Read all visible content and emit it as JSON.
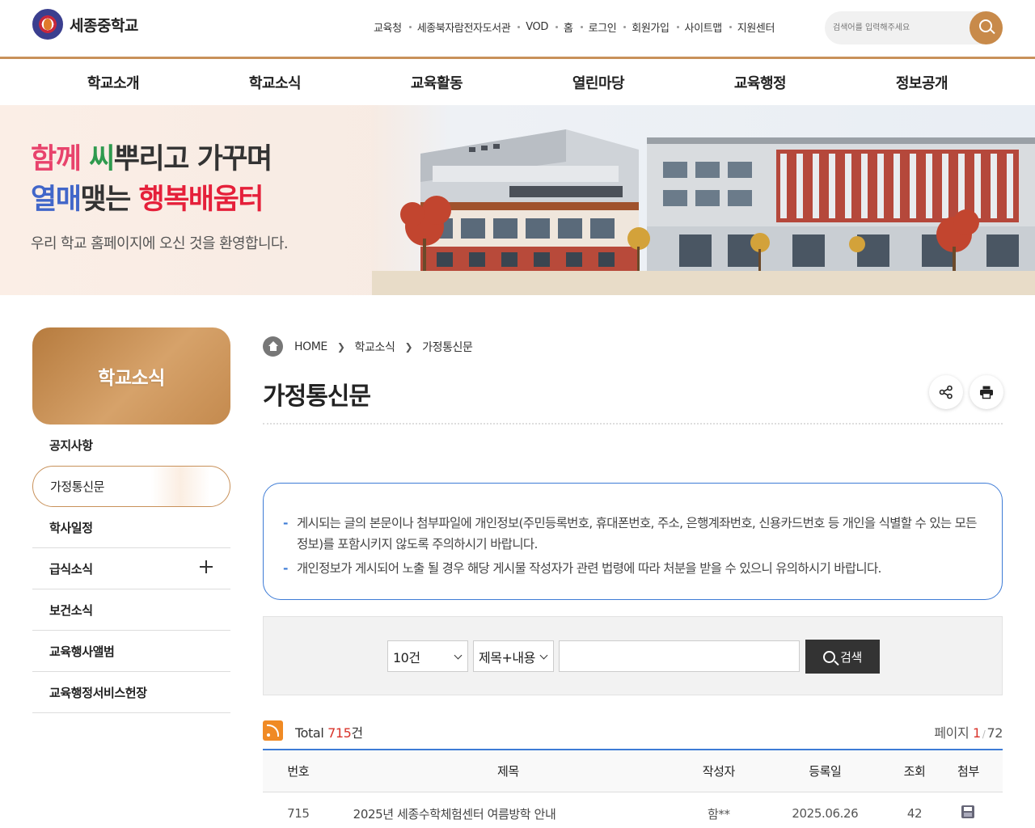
{
  "header": {
    "school_name": "세종중학교",
    "util_links": [
      "교육청",
      "세종북자람전자도서관",
      "VOD",
      "홈",
      "로그인",
      "회원가입",
      "사이트맵",
      "지원센터"
    ],
    "search_placeholder": "검색어를 입력해주세요"
  },
  "gnb": [
    "학교소개",
    "학교소식",
    "교육활동",
    "열린마당",
    "교육행정",
    "정보공개"
  ],
  "banner": {
    "l1a": "함께 ",
    "l1b": "씨",
    "l1c": "뿌리고 가꾸며",
    "l2a": "열매",
    "l2b": "맺는 ",
    "l2c": "행복배움터",
    "subtitle": "우리 학교 홈페이지에 오신 것을 환영합니다."
  },
  "sidebar": {
    "title": "학교소식",
    "items": [
      "공지사항",
      "가정통신문",
      "학사일정",
      "급식소식",
      "보건소식",
      "교육행사앨범",
      "교육행정서비스헌장"
    ]
  },
  "breadcrumb": [
    "HOME",
    "학교소식",
    "가정통신문"
  ],
  "page_title": "가정통신문",
  "notice": [
    "게시되는 글의 본문이나 첨부파일에 개인정보(주민등록번호, 휴대폰번호, 주소, 은행계좌번호, 신용카드번호 등 개인을 식별할 수 있는 모든 정보)를 포함시키지 않도록 주의하시기 바랍니다.",
    "개인정보가 게시되어 노출 될 경우 해당 게시물 작성자가 관련 법령에 따라 처분을 받을 수 있으니 유의하시기 바랍니다."
  ],
  "search": {
    "count_option": "10건",
    "field_option": "제목+내용",
    "keyword": "",
    "button": "검색"
  },
  "list_info": {
    "total_label": "Total ",
    "total": "715",
    "total_unit": "건",
    "page_label": "페이지 ",
    "current_page": "1",
    "total_pages": "72"
  },
  "table": {
    "headers": [
      "번호",
      "제목",
      "작성자",
      "등록일",
      "조회",
      "첨부"
    ],
    "rows": [
      {
        "no": "715",
        "title": "2025년 세종수학체험센터 여름방학 안내",
        "author": "함**",
        "date": "2025.06.26",
        "views": "42",
        "attachment": "file-icon"
      }
    ]
  },
  "colors": {
    "accent": "#c8915a",
    "notice_border": "#3d7bd6",
    "highlight": "#d9332a"
  }
}
